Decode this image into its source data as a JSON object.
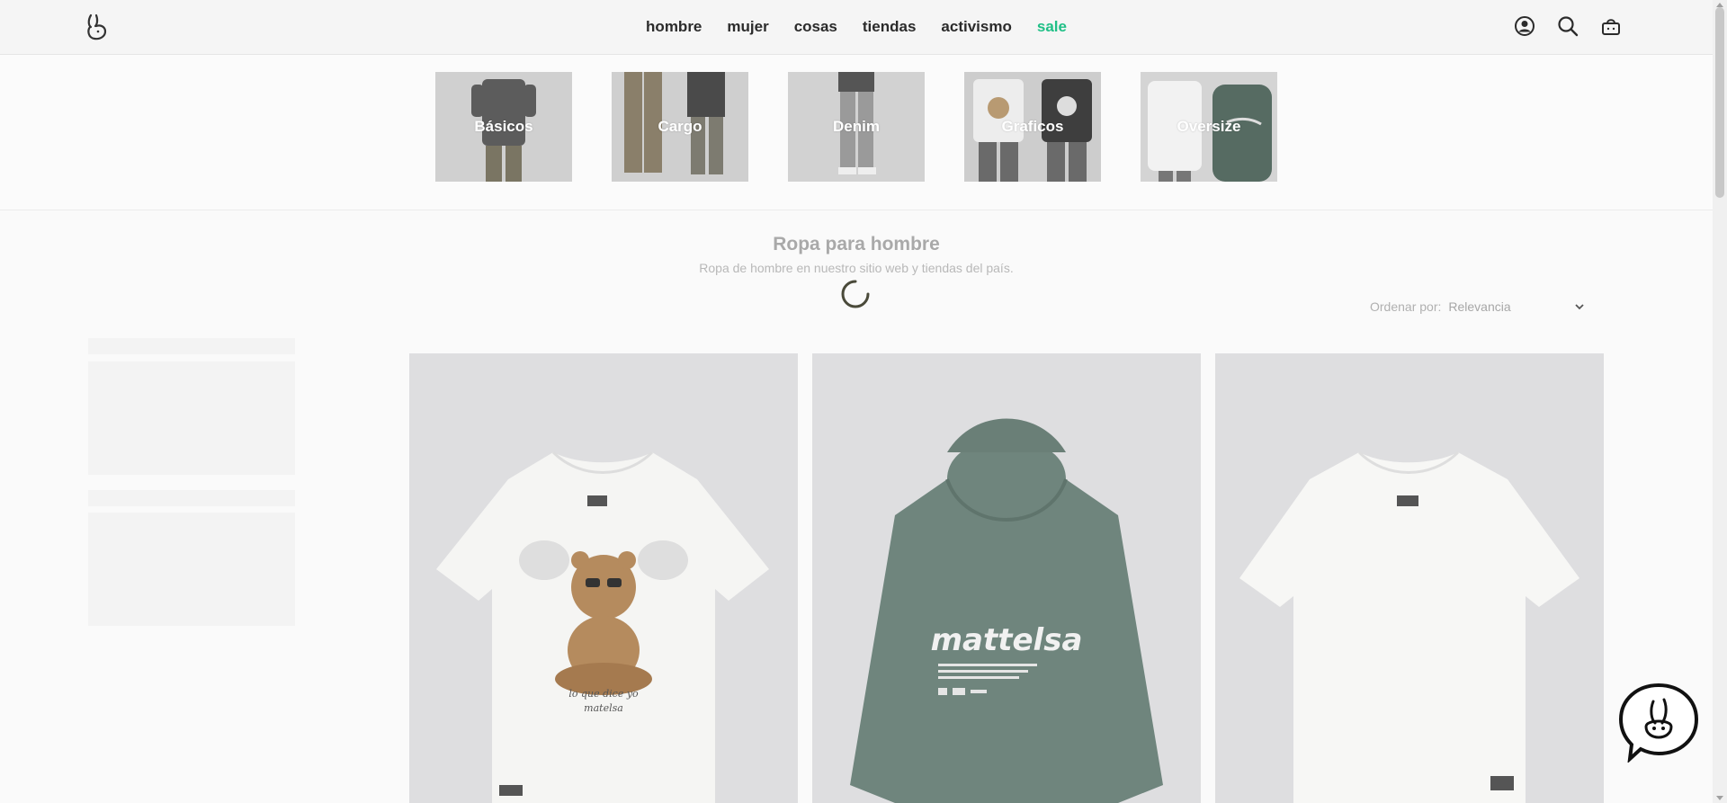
{
  "nav": {
    "items": [
      {
        "label": "hombre"
      },
      {
        "label": "mujer"
      },
      {
        "label": "cosas"
      },
      {
        "label": "tiendas"
      },
      {
        "label": "activismo"
      },
      {
        "label": "sale"
      }
    ]
  },
  "header_icons": [
    "account-icon",
    "search-icon",
    "cart-icon"
  ],
  "categories": [
    {
      "label": "Básicos"
    },
    {
      "label": "Cargo"
    },
    {
      "label": "Denim"
    },
    {
      "label": "Graficos"
    },
    {
      "label": "Oversize"
    }
  ],
  "listing": {
    "title": "Ropa para hombre",
    "subtitle": "Ropa de hombre en nuestro sitio web y tiendas del país."
  },
  "sort": {
    "label": "Ordenar por:",
    "value": "Relevancia"
  },
  "products": [
    {
      "image": "white-tshirt-bear-graphic",
      "print_text": "lo que dice yo matelsa"
    },
    {
      "image": "green-hoodie-back-print",
      "print_text": "mattelsa"
    },
    {
      "image": "white-plain-tshirt",
      "print_text": ""
    }
  ],
  "colors": {
    "sale": "#1fbf86",
    "nav_text": "#2b2b2b",
    "hoodie": "#6f857d"
  }
}
